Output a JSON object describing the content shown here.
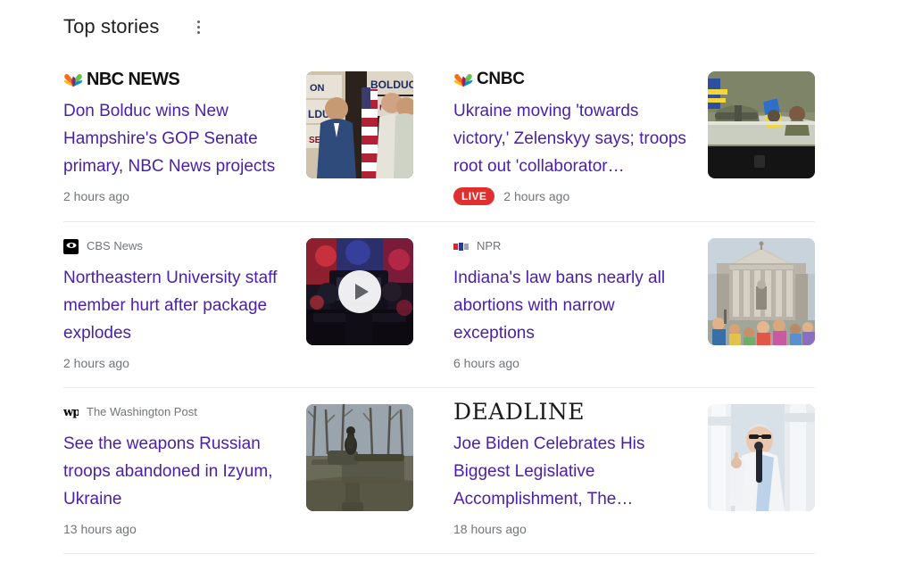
{
  "module": {
    "title": "Top stories",
    "overflow_icon": "more-vert-icon"
  },
  "stories": [
    {
      "source": {
        "name": "NBC NEWS",
        "logo_type": "wordmark-peacock",
        "icon": "nbc-news-logo"
      },
      "headline": "Don Bolduc wins New Hampshire's GOP Senate primary, NBC News projects",
      "timestamp": "2 hours ago",
      "badge": "",
      "thumbnail": {
        "icon": "thumbnail-bolduc-campaign",
        "has_video": false
      }
    },
    {
      "source": {
        "name": "CNBC",
        "logo_type": "wordmark-peacock",
        "icon": "cnbc-logo"
      },
      "headline": "Ukraine moving 'towards victory,' Zelenskyy says; troops root out 'collaborator…",
      "timestamp": "2 hours ago",
      "badge": "LIVE",
      "thumbnail": {
        "icon": "thumbnail-ukraine-armor",
        "has_video": false
      }
    },
    {
      "source": {
        "name": "CBS News",
        "logo_type": "favicon",
        "icon": "cbs-news-favicon"
      },
      "headline": "Northeastern University staff member hurt after package explodes",
      "timestamp": "2 hours ago",
      "badge": "",
      "thumbnail": {
        "icon": "thumbnail-police-night-scene",
        "has_video": true
      }
    },
    {
      "source": {
        "name": "NPR",
        "logo_type": "favicon",
        "icon": "npr-favicon"
      },
      "headline": "Indiana's law bans nearly all abortions with narrow exceptions",
      "timestamp": "6 hours ago",
      "badge": "",
      "thumbnail": {
        "icon": "thumbnail-statehouse-protest",
        "has_video": false
      }
    },
    {
      "source": {
        "name": "The Washington Post",
        "logo_type": "favicon",
        "icon": "washington-post-favicon"
      },
      "headline": "See the weapons Russian troops abandoned in Izyum, Ukraine",
      "timestamp": "13 hours ago",
      "badge": "",
      "thumbnail": {
        "icon": "thumbnail-abandoned-tank",
        "has_video": false
      }
    },
    {
      "source": {
        "name": "DEADLINE",
        "logo_type": "wordmark-serif",
        "icon": "deadline-logo"
      },
      "headline": "Joe Biden Celebrates His Biggest Legislative Accomplishment, The…",
      "timestamp": "18 hours ago",
      "badge": "",
      "thumbnail": {
        "icon": "thumbnail-biden-speaking",
        "has_video": false
      }
    }
  ],
  "colors": {
    "headline_visited": "#4b20a8",
    "meta_grey": "#70757a",
    "title_dark": "#202124",
    "live_red": "#e02f2f",
    "rule": "#ebebeb"
  }
}
